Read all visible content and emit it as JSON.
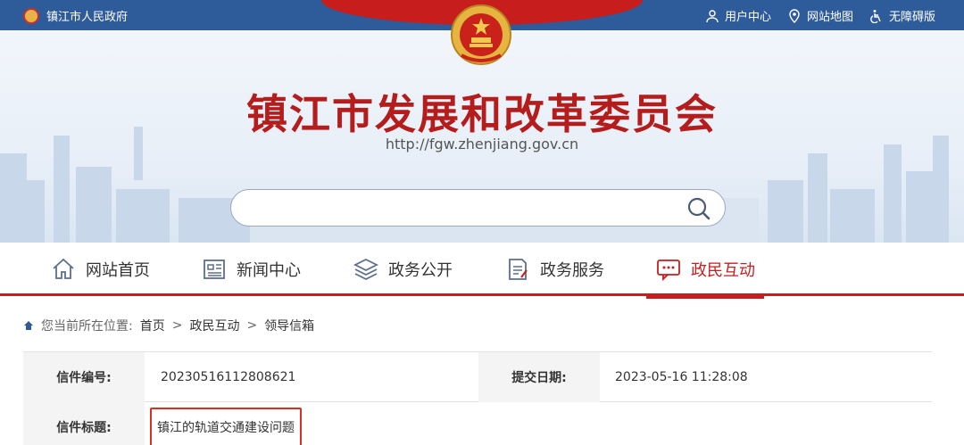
{
  "topbar": {
    "gov_label": "镇江市人民政府",
    "links": [
      {
        "label": "用户中心",
        "icon": "user-icon"
      },
      {
        "label": "网站地图",
        "icon": "map-pin-icon"
      },
      {
        "label": "无障碍版",
        "icon": "accessibility-icon"
      }
    ]
  },
  "banner": {
    "title": "镇江市发展和改革委员会",
    "url": "http://fgw.zhenjiang.gov.cn",
    "search_placeholder": ""
  },
  "nav": {
    "items": [
      {
        "label": "网站首页",
        "icon": "home-icon"
      },
      {
        "label": "新闻中心",
        "icon": "news-icon"
      },
      {
        "label": "政务公开",
        "icon": "layers-icon"
      },
      {
        "label": "政务服务",
        "icon": "document-edit-icon"
      },
      {
        "label": "政民互动",
        "icon": "chat-icon",
        "active": true
      }
    ]
  },
  "breadcrumb": {
    "prefix": "您当前所在位置:",
    "items": [
      "首页",
      "政民互动",
      "领导信箱"
    ],
    "separator": ">"
  },
  "letter": {
    "number_label": "信件编号:",
    "number_value": "20230516112808621",
    "date_label": "提交日期:",
    "date_value": "2023-05-16 11:28:08",
    "title_label": "信件标题:",
    "title_value": "镇江的轨道交通建设问题"
  },
  "colors": {
    "topbar": "#2e5b9a",
    "accent_red": "#c81d1d",
    "highlight_border": "#d93025"
  }
}
